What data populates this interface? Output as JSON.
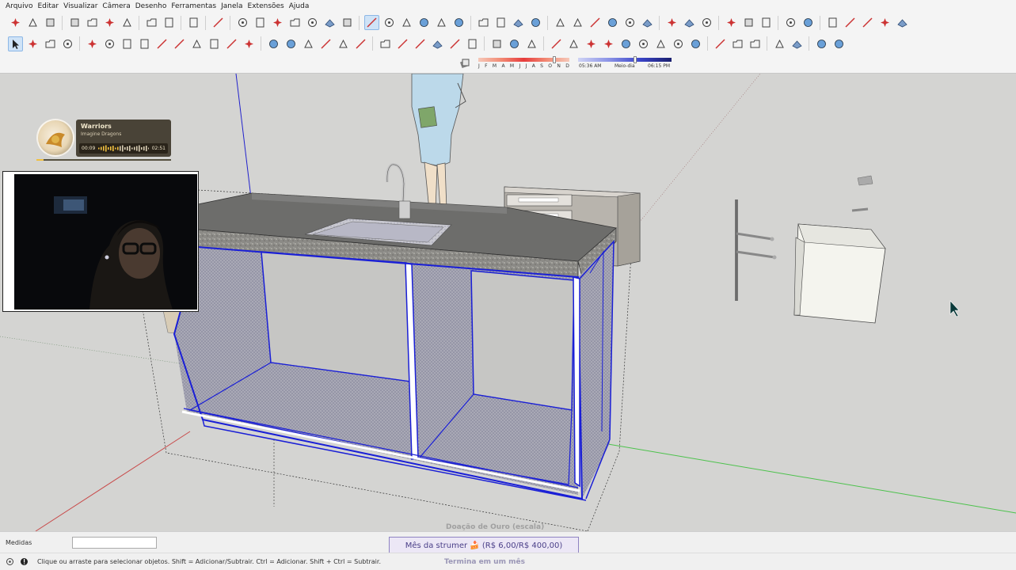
{
  "menu": [
    "Arquivo",
    "Editar",
    "Visualizar",
    "Câmera",
    "Desenho",
    "Ferramentas",
    "Janela",
    "Extensões",
    "Ajuda"
  ],
  "toolbar1_icons": [
    "new-file-icon",
    "open-file-icon",
    "save-icon",
    "sep",
    "cut-icon",
    "copy-icon",
    "paste-icon",
    "erase-icon",
    "sep",
    "undo-icon",
    "redo-icon",
    "sep",
    "print-icon",
    "sep",
    "model-info-icon",
    "sep",
    "iso-view-icon",
    "top-view-icon",
    "front-view-icon",
    "right-view-icon",
    "back-view-icon",
    "left-view-icon",
    "bottom-view-icon",
    "sep",
    "xray-icon",
    "back-edges-icon",
    "wireframe-icon",
    "hidden-line-icon",
    "shaded-icon",
    "textured-icon",
    "sep",
    "section-plane-icon",
    "display-section-icon",
    "section-cuts-icon",
    "section-fill-icon",
    "sep",
    "components-icon",
    "materials-icon",
    "styles-icon",
    "tags-icon",
    "scenes-icon",
    "outliner-icon",
    "sep",
    "warehouse-icon",
    "share-model-icon",
    "extension-warehouse-icon",
    "sep",
    "add-location-icon",
    "toggle-terrain-icon",
    "photo-texture-icon",
    "sep",
    "geolocation-icon",
    "cloud-icon",
    "sep",
    "settings-icon",
    "layout-icon",
    "info-icon",
    "cart-icon",
    "account-icon"
  ],
  "toolbar2_icons": [
    "select-arrow-icon",
    "make-component-icon",
    "paint-bucket-icon",
    "eraser-icon",
    "sep",
    "line-icon",
    "freehand-icon",
    "rectangle-icon",
    "rotated-rectangle-icon",
    "circle-icon",
    "polygon-icon",
    "arc-icon",
    "two-point-arc-icon",
    "three-point-arc-icon",
    "pie-icon",
    "sep",
    "move-icon",
    "push-pull-icon",
    "rotate-icon",
    "follow-me-icon",
    "scale-icon",
    "offset-icon",
    "sep",
    "tape-measure-icon",
    "dimension-icon",
    "protractor-icon",
    "text-icon",
    "axes-icon",
    "3d-text-icon",
    "sep",
    "sandbox-icon",
    "outer-shell-icon",
    "solid-tools-icon",
    "sep",
    "orbit-icon",
    "pan-icon",
    "zoom-icon",
    "zoom-window-icon",
    "zoom-extents-icon",
    "previous-view-icon",
    "position-camera-icon",
    "walk-icon",
    "look-around-icon",
    "sep",
    "flatten-icon",
    "box-icon",
    "solid-box-icon",
    "sep",
    "mirror-icon",
    "sweep-icon",
    "sep",
    "panel-icon",
    "grip-icon"
  ],
  "shadow": {
    "months": [
      "J",
      "F",
      "M",
      "A",
      "M",
      "J",
      "J",
      "A",
      "S",
      "O",
      "N",
      "D"
    ],
    "time_start": "05:36 AM",
    "time_mid": "Meio-dia",
    "time_end": "06:15 PM"
  },
  "music": {
    "title": "Warriors",
    "artist": "Imagine Dragons",
    "elapsed": "00:09",
    "total": "02:51",
    "progress": 0.05
  },
  "overlay": {
    "top_text": "Doação de Ouro (escala)",
    "goal": "Mês da strumer 🍰 (R$ 6,00/R$ 400,00)",
    "goal_sub": "Termina em um mês"
  },
  "measure": {
    "label": "Medidas",
    "value": ""
  },
  "status": {
    "text": "Clique ou arraste para selecionar objetos. Shift = Adicionar/Subtrair. Ctrl = Adicionar. Shift + Ctrl = Subtrair."
  },
  "colors": {
    "selection": "#1a1fd6",
    "axis_red": "#c84a4a",
    "axis_green": "#4cc24c",
    "axis_blue": "#2222cc"
  }
}
